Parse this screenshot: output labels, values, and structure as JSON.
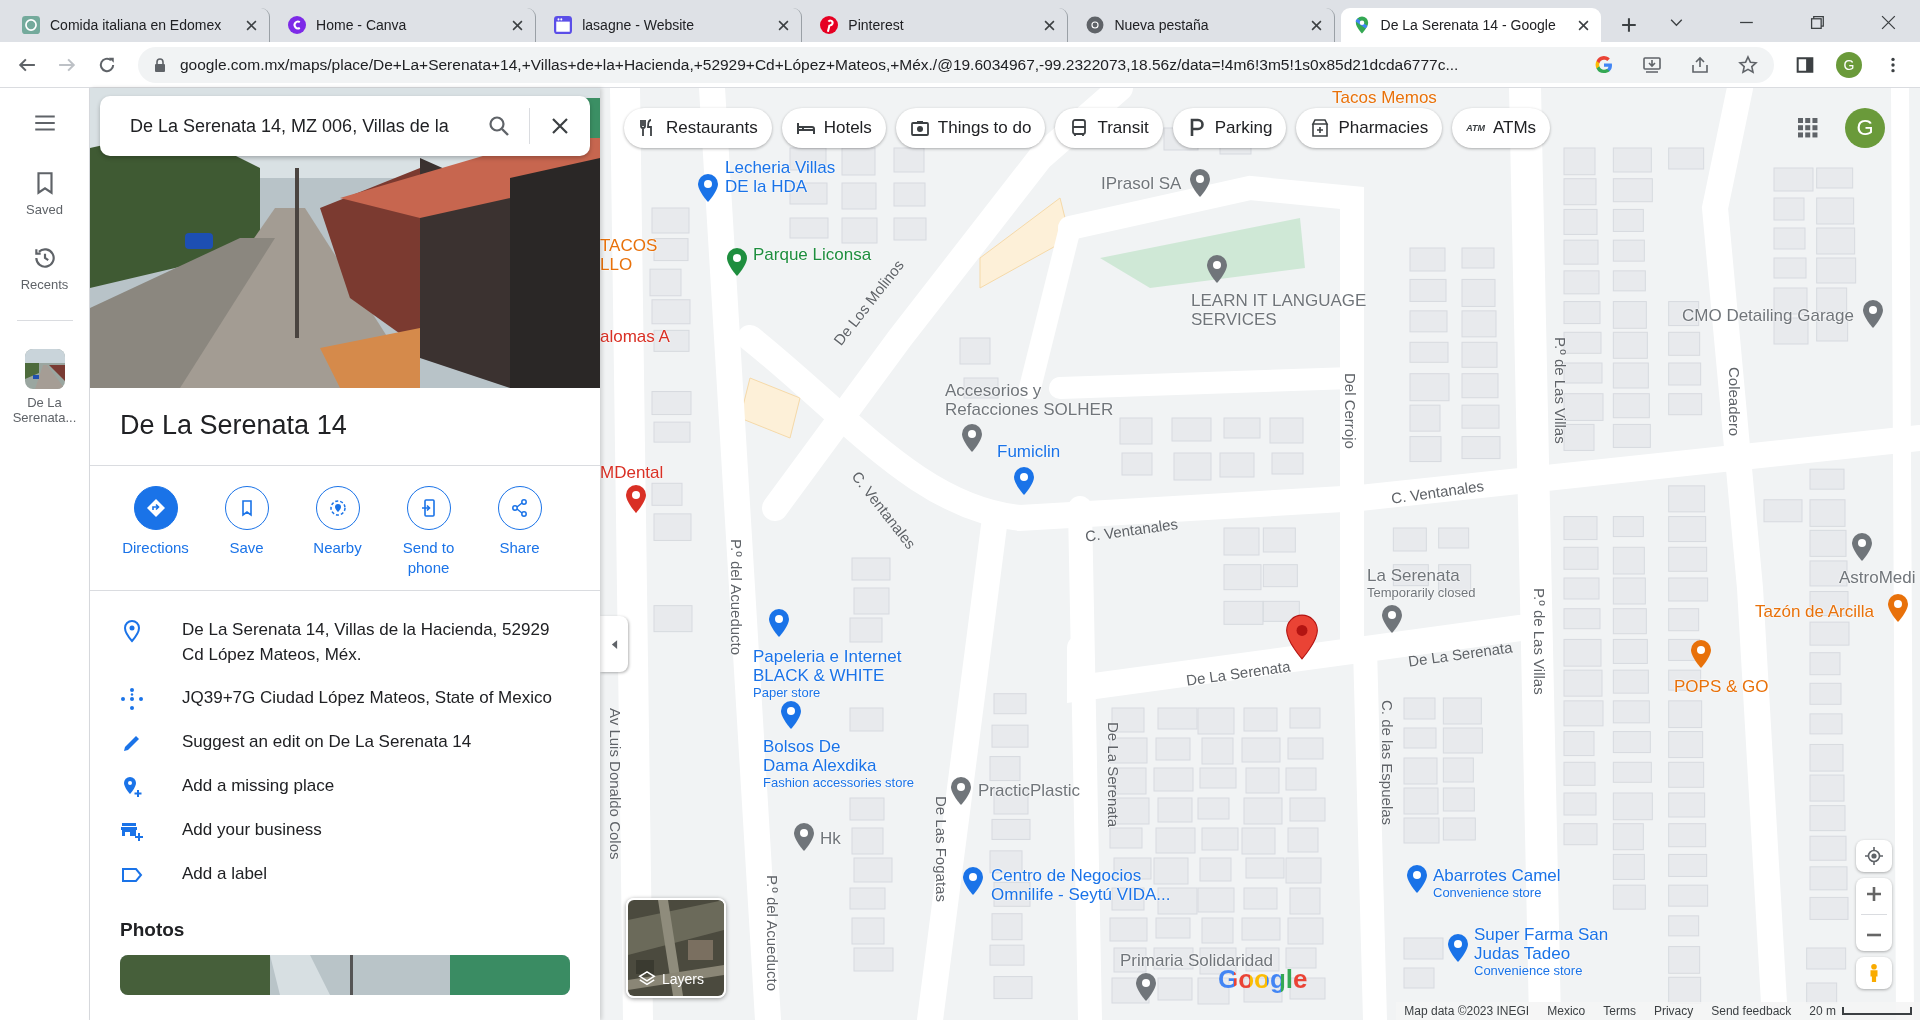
{
  "browser": {
    "tabs": [
      {
        "title": "Comida italiana en Edomex",
        "kind": "chatgpt",
        "selected": false
      },
      {
        "title": "Home - Canva",
        "kind": "canva",
        "selected": false
      },
      {
        "title": "lasagne - Website",
        "kind": "website",
        "selected": false
      },
      {
        "title": "Pinterest",
        "kind": "pinterest",
        "selected": false
      },
      {
        "title": "Nueva pestaña",
        "kind": "chrome",
        "selected": false
      },
      {
        "title": "De La Serenata 14 - Google",
        "kind": "maps",
        "selected": true
      }
    ],
    "address": "google.com.mx/maps/place/De+La+Serenata+14,+Villas+de+la+Hacienda,+52929+Cd+López+Mateos,+Méx./@19.6034967,-99.2322073,18.56z/data=!4m6!3m5!1s0x85d21dcda6777c...",
    "profile_initial": "G"
  },
  "rail": {
    "items": [
      {
        "label": "Saved",
        "kind": "saved"
      },
      {
        "label": "Recents",
        "kind": "recents"
      }
    ],
    "recent": {
      "label": "De La Serenata..."
    }
  },
  "place": {
    "search": {
      "value": "De La Serenata 14, MZ 006, Villas de la"
    },
    "title": "De La Serenata 14",
    "actions": [
      {
        "label": "Directions",
        "kind": "directions",
        "filled": true
      },
      {
        "label": "Save",
        "kind": "save",
        "filled": false
      },
      {
        "label": "Nearby",
        "kind": "nearby",
        "filled": false
      },
      {
        "label": "Send to phone",
        "kind": "send",
        "filled": false
      },
      {
        "label": "Share",
        "kind": "share",
        "filled": false
      }
    ],
    "info": [
      {
        "text": "De La Serenata 14, Villas de la Hacienda, 52929 Cd López Mateos, Méx.",
        "kind": "address"
      },
      {
        "text": "JQ39+7G Ciudad López Mateos, State of Mexico",
        "kind": "plus_code"
      },
      {
        "text": "Suggest an edit on De La Serenata 14",
        "kind": "edit"
      },
      {
        "text": "Add a missing place",
        "kind": "add_place"
      },
      {
        "text": "Add your business",
        "kind": "add_business"
      },
      {
        "text": "Add a label",
        "kind": "label"
      }
    ],
    "photos_heading": "Photos"
  },
  "map": {
    "chips": [
      {
        "label": "Restaurants",
        "kind": "restaurants"
      },
      {
        "label": "Hotels",
        "kind": "hotels"
      },
      {
        "label": "Things to do",
        "kind": "things"
      },
      {
        "label": "Transit",
        "kind": "transit"
      },
      {
        "label": "Parking",
        "kind": "parking"
      },
      {
        "label": "Pharmacies",
        "kind": "pharmacies"
      },
      {
        "label": "ATMs",
        "kind": "atms",
        "icon_text": "ATM"
      }
    ],
    "profile_initial": "G",
    "places": [
      {
        "name": "Tacos Memos",
        "color": "#e8710a"
      },
      {
        "name": "Lecheria Villas DE la HDA",
        "color": "#1a73e8"
      },
      {
        "name": "IPrasol SA",
        "color": "#70757a"
      },
      {
        "name": "TACOS LLO",
        "color": "#e8710a"
      },
      {
        "name": "Parque Liconsa",
        "color": "#1e8e3e"
      },
      {
        "name": "LEARN IT LANGUAGE SERVICES",
        "color": "#70757a"
      },
      {
        "name": "CMO Detailing Garage",
        "color": "#70757a"
      },
      {
        "name": "alomas A",
        "color": "#d93025"
      },
      {
        "name": "Accesorios y Refacciones SOLHER",
        "color": "#70757a"
      },
      {
        "name": "Fumiclin",
        "color": "#1a73e8"
      },
      {
        "name": "MDental",
        "color": "#d93025"
      },
      {
        "name": "La Serenata",
        "subtitle": "Temporarily closed",
        "color": "#70757a"
      },
      {
        "name": "AstroMedi",
        "color": "#70757a"
      },
      {
        "name": "Tazón de Arcilla",
        "color": "#e8710a"
      },
      {
        "name": "Papeleria e Internet BLACK & WHITE",
        "subtitle": "Paper store",
        "color": "#1a73e8"
      },
      {
        "name": "POPS & GO",
        "color": "#e8710a"
      },
      {
        "name": "Bolsos De Dama Alexdika",
        "subtitle": "Fashion accessories store",
        "color": "#1a73e8"
      },
      {
        "name": "PracticPlastic",
        "color": "#70757a"
      },
      {
        "name": "Hk",
        "color": "#70757a"
      },
      {
        "name": "Centro de Negocios Omnilife - Seytú VIDA...",
        "color": "#1a73e8"
      },
      {
        "name": "Abarrotes Camel",
        "subtitle": "Convenience store",
        "color": "#1a73e8"
      },
      {
        "name": "Super Farma San Judas Tadeo",
        "subtitle": "Convenience store",
        "color": "#1a73e8"
      },
      {
        "name": "Primaria Solidaridad",
        "color": "#70757a"
      }
    ],
    "streets": [
      "De Los Molinos",
      "C. Ventanales",
      "C. Ventanales",
      "C. Ventanales",
      "Del Cerrojo",
      "P.º de Las Villas",
      "P.º de Las Villas",
      "Coleadero",
      "De La Serenata",
      "De La Serenata",
      "De La Serenata",
      "C. de las Espuelas",
      "P.º del Acueducto",
      "P.º del Acueducto",
      "De Las Fogatas",
      "Av Luis Donaldo Colos"
    ],
    "layers_label": "Layers",
    "logo": "Google",
    "footer": {
      "map_data": "Map data ©2023 INEGI",
      "links": [
        "Mexico",
        "Terms",
        "Privacy",
        "Send feedback"
      ],
      "scale": "20 m"
    }
  }
}
